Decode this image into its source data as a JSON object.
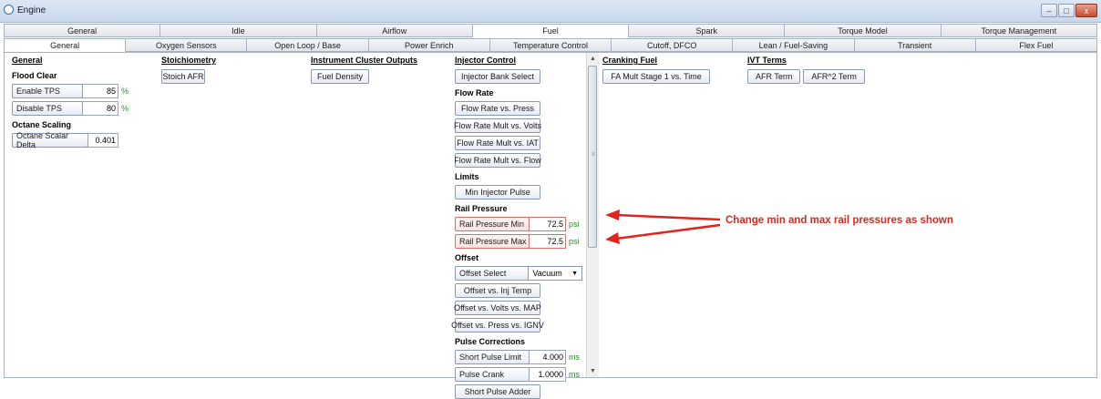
{
  "window": {
    "title": "Engine",
    "min_label": "–",
    "max_label": "□",
    "close_label": "x"
  },
  "tabs_top": [
    "General",
    "Idle",
    "Airflow",
    "Fuel",
    "Spark",
    "Torque Model",
    "Torque Management"
  ],
  "tabs_top_active": 3,
  "tabs_sub": [
    "General",
    "Oxygen Sensors",
    "Open Loop / Base",
    "Power Enrich",
    "Temperature Control",
    "Cutoff, DFCO",
    "Lean / Fuel-Saving",
    "Transient",
    "Flex Fuel"
  ],
  "tabs_sub_active": 0,
  "general": {
    "title": "General",
    "flood_clear": "Flood Clear",
    "enable_tps": {
      "label": "Enable TPS",
      "value": "85",
      "unit": "%"
    },
    "disable_tps": {
      "label": "Disable TPS",
      "value": "80",
      "unit": "%"
    },
    "octane_scaling": "Octane Scaling",
    "octane_scalar_delta": {
      "label": "Octane Scalar Delta",
      "value": "0.401"
    }
  },
  "stoich": {
    "title": "Stoichiometry",
    "button": "Stoich AFR"
  },
  "cluster": {
    "title": "Instrument Cluster Outputs",
    "button": "Fuel Density"
  },
  "injector": {
    "title": "Injector Control",
    "bank_select": "Injector Bank Select",
    "flow_rate_title": "Flow Rate",
    "flow_buttons": [
      "Flow Rate vs. Press",
      "Flow Rate Mult vs. Volts",
      "Flow Rate Mult vs. IAT",
      "Flow Rate Mult vs. Flow"
    ],
    "limits_title": "Limits",
    "min_injector_pulse": "Min Injector Pulse",
    "rail_title": "Rail Pressure",
    "rail_min": {
      "label": "Rail Pressure Min",
      "value": "72.5",
      "unit": "psi"
    },
    "rail_max": {
      "label": "Rail Pressure Max",
      "value": "72.5",
      "unit": "psi"
    },
    "offset_title": "Offset",
    "offset_select": {
      "label": "Offset Select",
      "value": "Vacuum"
    },
    "offset_buttons": [
      "Offset vs. Inj Temp",
      "Offset vs. Volts vs. MAP",
      "Offset vs. Press vs. IGNV"
    ],
    "pulse_title": "Pulse Corrections",
    "short_pulse_limit": {
      "label": "Short Pulse Limit",
      "value": "4.000",
      "unit": "ms"
    },
    "pulse_crank": {
      "label": "Pulse Crank",
      "value": "1.0000",
      "unit": "ms"
    },
    "short_pulse_adder": "Short Pulse Adder"
  },
  "cranking": {
    "title": "Cranking Fuel",
    "button": "FA Mult Stage 1 vs. Time"
  },
  "ivt": {
    "title": "IVT Terms",
    "buttons": [
      "AFR Term",
      "AFR^2 Term"
    ]
  },
  "annotation": "Change min and max rail pressures as shown",
  "colors": {
    "annotation": "#e2241b",
    "unit": "#2e8b2e",
    "highlight_border": "#d9706b"
  }
}
